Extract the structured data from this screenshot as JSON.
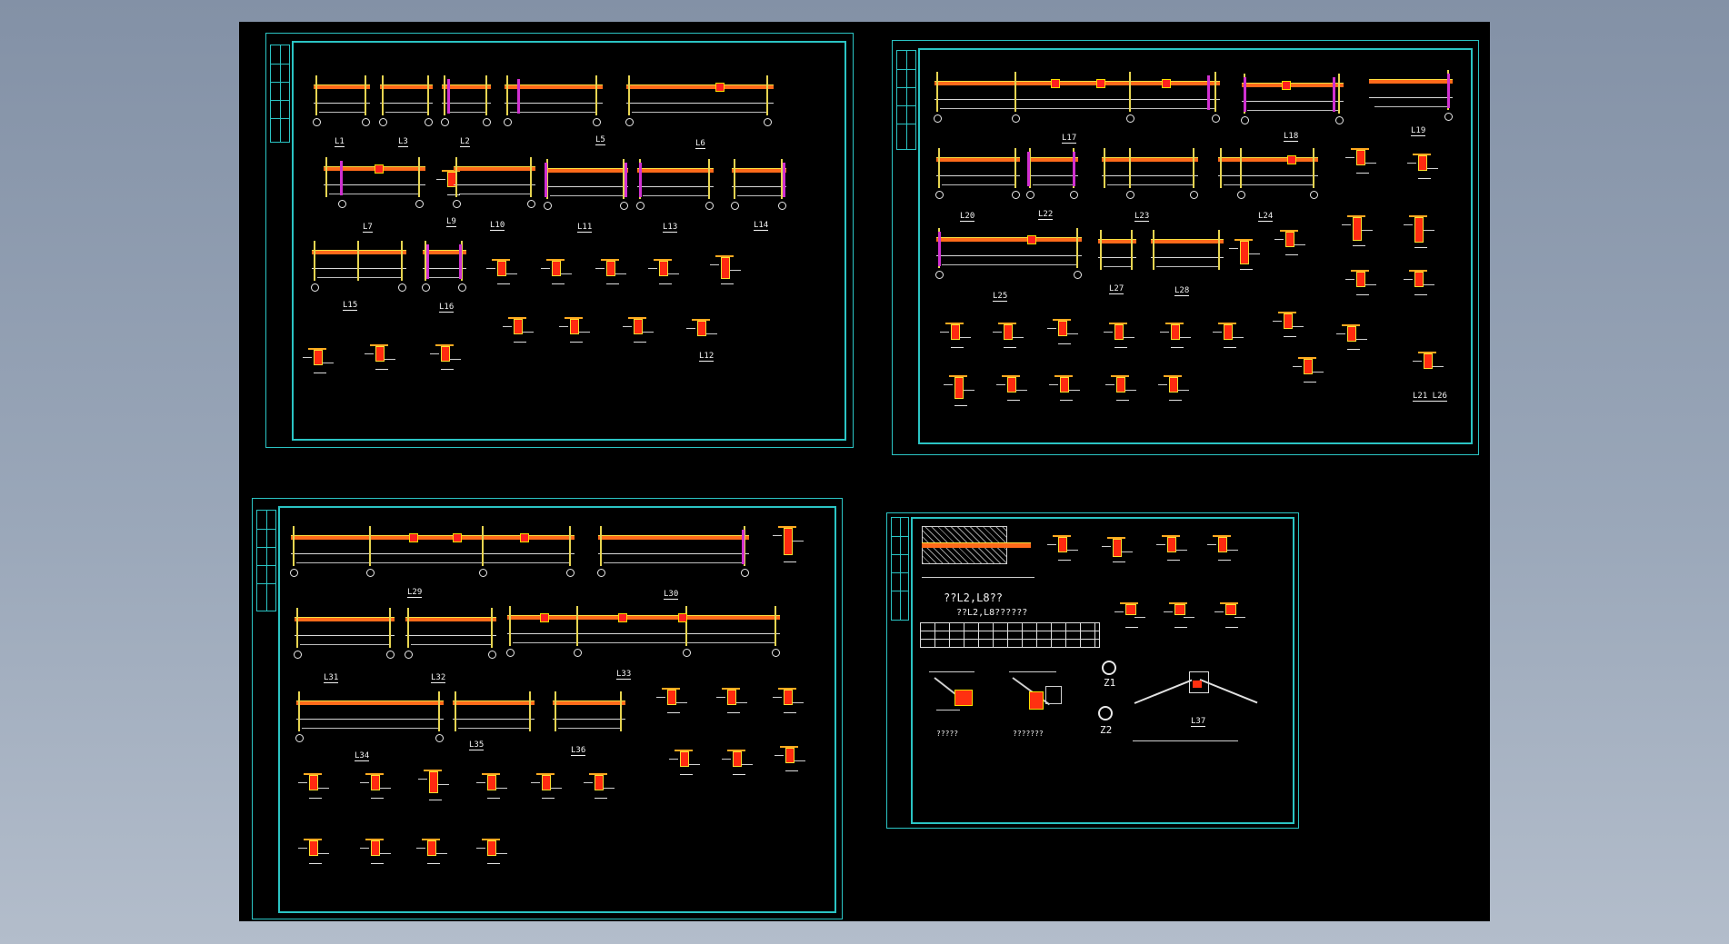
{
  "colors": {
    "background": "#000000",
    "frame": "#2bc4c4",
    "beam": "#ff6a1a",
    "beam_edge": "#ffdf40",
    "column": "#e6d450",
    "stirrup": "#d030d0",
    "section_fill": "#ff2a10",
    "text": "#f2f2f2"
  },
  "sheet1": {
    "labels": [
      "L1",
      "L3",
      "L2",
      "L5",
      "L6",
      "L7",
      "L9",
      "L10",
      "L11",
      "L13",
      "L14",
      "L15",
      "L16",
      "L12"
    ]
  },
  "sheet2": {
    "labels": [
      "L17",
      "L18",
      "L19",
      "L20",
      "L22",
      "L23",
      "L24",
      "L25",
      "L27",
      "L28",
      "L21 L26"
    ]
  },
  "sheet3": {
    "labels": [
      "L29",
      "L30",
      "L31",
      "L32",
      "L33",
      "L34",
      "L35",
      "L36"
    ]
  },
  "sheet4": {
    "heading": "??L2,L8??",
    "caption1": "??L2,L8??????",
    "z1": "Z1",
    "z2": "Z2",
    "beam37": "L37",
    "sub_left": "?????",
    "sub_mid": "???????"
  }
}
